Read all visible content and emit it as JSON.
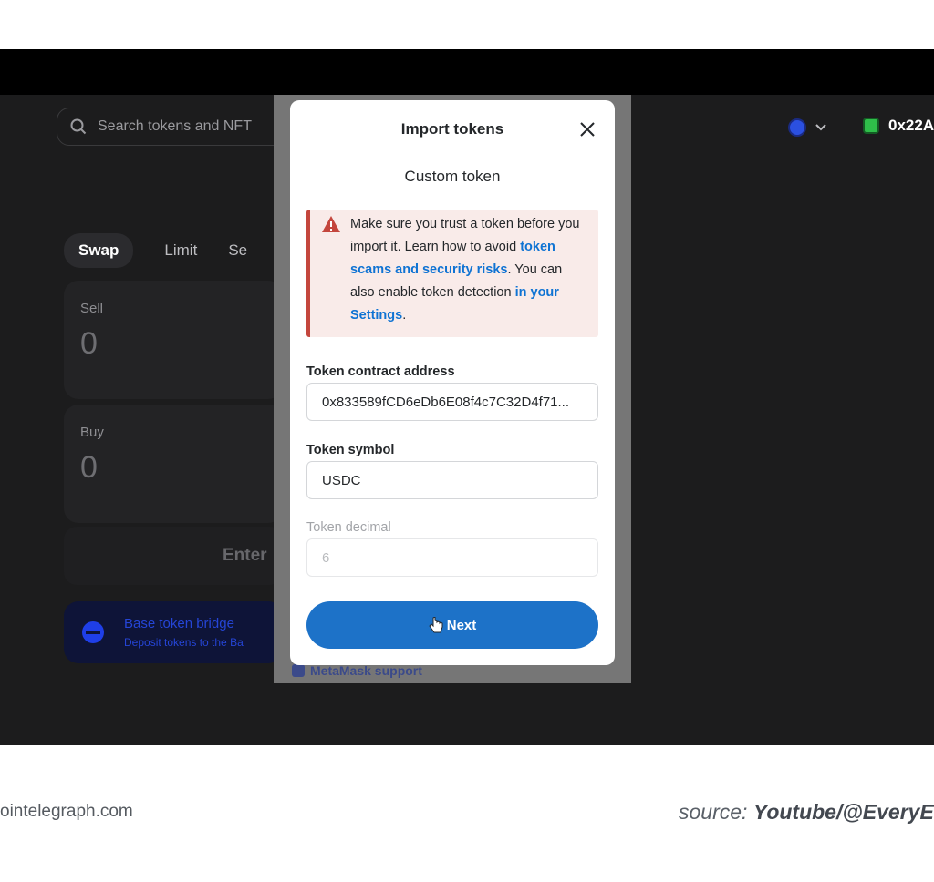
{
  "app": {
    "search_placeholder": "Search tokens and NFT",
    "account_label": "0x22A",
    "tabs": [
      "Swap",
      "Limit",
      "Se"
    ],
    "sell_label": "Sell",
    "sell_amount": "0",
    "buy_label": "Buy",
    "buy_amount": "0",
    "enter_label": "Enter",
    "bridge_title": "Base token bridge",
    "bridge_sub": "Deposit tokens to the Ba",
    "support_label": "MetaMask support"
  },
  "modal": {
    "title": "Import tokens",
    "subtitle": "Custom token",
    "warning": {
      "line1": "Make sure you trust a token before you import it. Learn how to avoid",
      "link1": "token scams and security risks",
      "line2": ". You can also enable token detection",
      "link2": "in your Settings",
      "line3": "."
    },
    "address_label": "Token contract address",
    "address_value": "0x833589fCD6eDb6E08f4c7C32D4f71...",
    "symbol_label": "Token symbol",
    "symbol_value": "USDC",
    "decimal_label": "Token decimal",
    "decimal_value": "6",
    "next_label": "Next"
  },
  "footer": {
    "left": "ointelegraph.com",
    "source_prefix": "source: ",
    "source_name": "Youtube/@EveryE"
  },
  "colors": {
    "app_background": "#1c1c1d",
    "primary_button": "#1d72c8",
    "link": "#0f73d3",
    "warning_bar": "#c4463d",
    "warning_background": "#f9ebe9"
  }
}
